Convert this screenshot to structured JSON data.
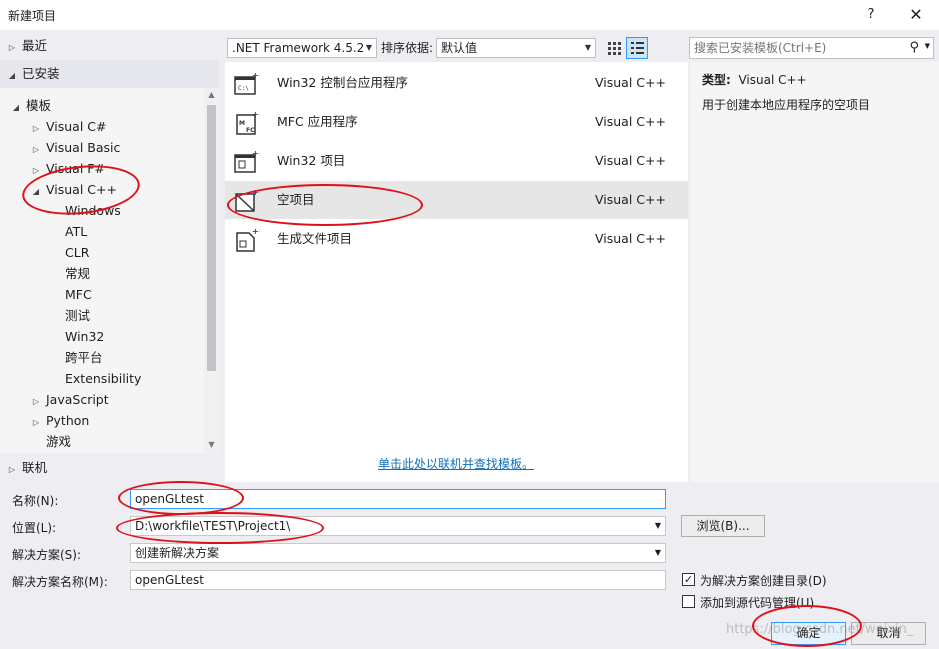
{
  "window": {
    "title": "新建项目",
    "help": "?",
    "close": "✕"
  },
  "left": {
    "recent": "最近",
    "installed": "已安装",
    "online": "联机",
    "tree": [
      {
        "label": "模板"
      },
      {
        "label": "Visual C#"
      },
      {
        "label": "Visual Basic"
      },
      {
        "label": "Visual F#"
      },
      {
        "label": "Visual C++"
      },
      {
        "label": "Windows"
      },
      {
        "label": "ATL"
      },
      {
        "label": "CLR"
      },
      {
        "label": "常规"
      },
      {
        "label": "MFC"
      },
      {
        "label": "测试"
      },
      {
        "label": "Win32"
      },
      {
        "label": "跨平台"
      },
      {
        "label": "Extensibility"
      },
      {
        "label": "JavaScript"
      },
      {
        "label": "Python"
      },
      {
        "label": "游戏"
      }
    ]
  },
  "toolbar": {
    "framework": ".NET Framework 4.5.2",
    "sort_label": "排序依据:",
    "sort_value": "默认值",
    "search_placeholder": "搜索已安装模板(Ctrl+E)"
  },
  "templates": [
    {
      "name": "Win32 控制台应用程序",
      "lang": "Visual C++"
    },
    {
      "name": "MFC 应用程序",
      "lang": "Visual C++"
    },
    {
      "name": "Win32 项目",
      "lang": "Visual C++"
    },
    {
      "name": "空项目",
      "lang": "Visual C++"
    },
    {
      "name": "生成文件项目",
      "lang": "Visual C++"
    }
  ],
  "online_link": "单击此处以联机并查找模板。",
  "detail": {
    "type_label": "类型:",
    "type_value": "Visual C++",
    "description": "用于创建本地应用程序的空项目"
  },
  "form": {
    "name_label": "名称(N):",
    "name_value": "openGLtest",
    "location_label": "位置(L):",
    "location_value": "D:\\workfile\\TEST\\Project1\\",
    "browse": "浏览(B)...",
    "solution_label": "解决方案(S):",
    "solution_value": "创建新解决方案",
    "solution_name_label": "解决方案名称(M):",
    "solution_name_value": "openGLtest",
    "create_dir": "为解决方案创建目录(D)",
    "create_dir_checked": true,
    "source_control": "添加到源代码管理(U)",
    "source_control_checked": false,
    "ok": "确定",
    "cancel": "取消"
  },
  "watermark": "https://blog.csdn.net/weixin_"
}
